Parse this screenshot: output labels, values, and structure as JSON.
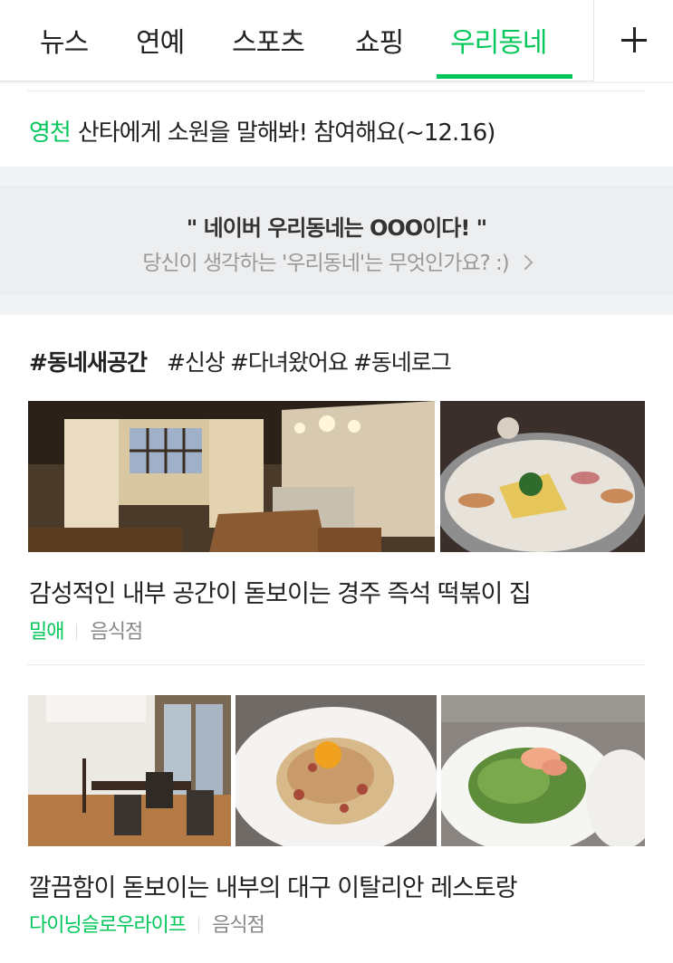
{
  "tabs": [
    {
      "label": "뉴스",
      "active": false
    },
    {
      "label": "연예",
      "active": false
    },
    {
      "label": "스포츠",
      "active": false
    },
    {
      "label": "쇼핑",
      "active": false
    },
    {
      "label": "우리동네",
      "active": true
    }
  ],
  "add_tab_icon": "plus-icon",
  "notice": {
    "region": "영천",
    "text": "산타에게 소원을 말해봐! 참여해요(~12.16)"
  },
  "prompt": {
    "title": "\" 네이버 우리동네는 OOO이다! \"",
    "subtitle": "당신이 생각하는 '우리동네'는 무엇인가요? :)"
  },
  "feed": {
    "main_tag": "#동네새공간",
    "tags": [
      "#신상",
      "#다녀왔어요",
      "#동네로그"
    ],
    "items": [
      {
        "title": "감성적인 내부 공간이 돋보이는 경주 즉석 떡볶이 집",
        "author": "밀애",
        "category": "음식점"
      },
      {
        "title": "깔끔함이 돋보이는 내부의 대구 이탈리안 레스토랑",
        "author": "다이닝슬로우라이프",
        "category": "음식점"
      }
    ]
  },
  "colors": {
    "accent": "#03c75a",
    "text": "#222222",
    "muted": "#888888",
    "background": "#f2f3f5"
  }
}
